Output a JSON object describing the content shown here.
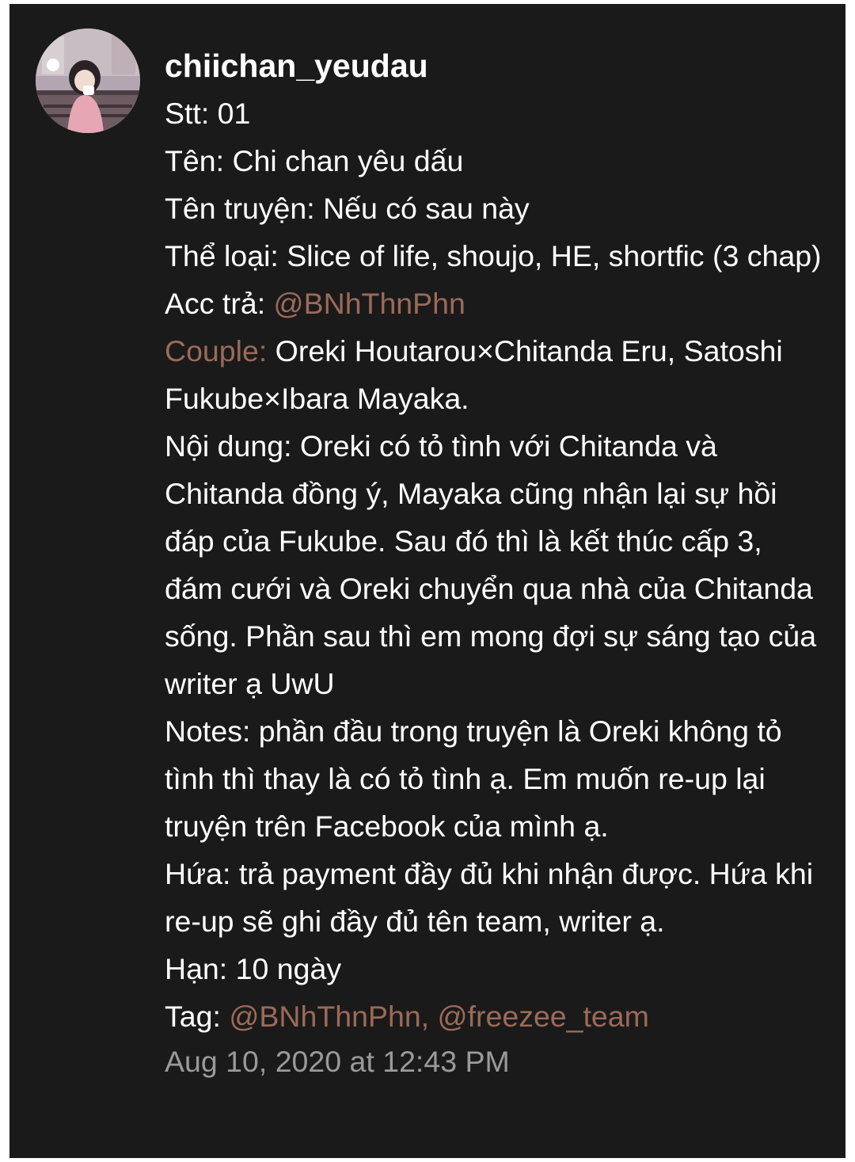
{
  "post": {
    "username": "chiichan_yeudau",
    "avatar_icon": "profile-avatar-anime-girl",
    "lines": {
      "stt": "Stt: 01",
      "ten": "Tên: Chi chan yêu dấu",
      "ten_truyen": "Tên truyện: Nếu có sau này",
      "the_loai": "Thể loại: Slice of life, shoujo, HE, shortfic (3 chap)",
      "acc_tra_label": "Acc trả: ",
      "acc_tra_mention": "@BNhThnPhn",
      "couple_label": "Couple:",
      "couple_value": " Oreki Houtarou×Chitanda Eru, Satoshi Fukube×Ibara Mayaka.",
      "noi_dung": "Nội dung: Oreki có tỏ tình với Chitanda và Chitanda đồng ý, Mayaka cũng nhận lại sự hồi đáp của Fukube. Sau đó thì là kết thúc cấp 3, đám cưới và Oreki chuyển qua nhà của Chitanda sống. Phần sau thì em mong đợi sự sáng tạo của writer ạ UwU",
      "notes": "Notes: phần đầu trong truyện là Oreki không tỏ tình thì thay là có tỏ tình ạ. Em muốn re-up lại truyện trên Facebook của mình ạ.",
      "hua": "Hứa: trả payment đầy đủ khi nhận được. Hứa khi re-up sẽ ghi đầy đủ tên team, writer ạ.",
      "han": "Hạn: 10 ngày",
      "tag_label": "Tag: ",
      "tag_mentions": "@BNhThnPhn, @freezee_team"
    },
    "timestamp": "Aug 10, 2020 at 12:43 PM"
  },
  "colors": {
    "background": "#1a1a1a",
    "text": "#ffffff",
    "mention": "#9c6a58",
    "timestamp": "#9a9a9a"
  }
}
